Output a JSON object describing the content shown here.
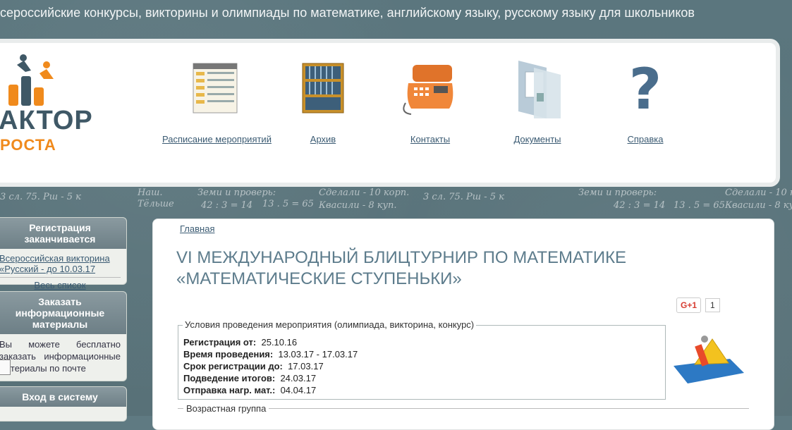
{
  "site_title": "Всероссийские конкурсы, викторины и олимпиады по математике, английскому языку, русскому языку для школьников",
  "logo": {
    "word1": "АКТОР",
    "word2": "РОСТА",
    "colors": {
      "primary": "#3f5866",
      "accent": "#f08a1c"
    }
  },
  "nav": [
    {
      "label": "Расписание мероприятий",
      "icon": "schedule-table-icon"
    },
    {
      "label": "Архив",
      "icon": "archive-shelf-icon"
    },
    {
      "label": "Контакты",
      "icon": "phone-icon"
    },
    {
      "label": "Документы",
      "icon": "documents-folder-icon"
    },
    {
      "label": "Справка",
      "icon": "help-question-icon"
    }
  ],
  "chalk_text": [
    "3 сл. 75. Рш - 5 к",
    "Наш.",
    "Тёльше",
    "Земи и проверь:",
    "42 : 3 = 14",
    "13 . 5 = 65",
    "Сделали - 10 корп.",
    "Квасили - 8 куп."
  ],
  "sidebar": {
    "registration": {
      "title": "Регистрация заканчивается",
      "item": "Всероссийская викторина «Русский - до 10.03.17",
      "all_link": "Весь список"
    },
    "materials": {
      "title": "Заказать информационные материалы",
      "text": "Вы можете бесплатно заказать информационные материалы по почте"
    },
    "login": {
      "title": "Вход в систему"
    }
  },
  "main": {
    "breadcrumb": "Главная",
    "title": "VI МЕЖДУНАРОДНЫЙ БЛИЦТУРНИР ПО МАТЕМАТИКЕ «МАТЕМАТИЧЕСКИЕ СТУПЕНЬКИ»",
    "gplus_label": "G+1",
    "gplus_count": "1",
    "conditions": {
      "legend": "Условия проведения мероприятия (олимпиада, викторина, конкурс)",
      "rows": [
        {
          "label": "Регистрация от:",
          "value": "25.10.16"
        },
        {
          "label": "Время проведения:",
          "value": "13.03.17 - 17.03.17"
        },
        {
          "label": "Срок регистрации до:",
          "value": "17.03.17"
        },
        {
          "label": "Подведение итогов:",
          "value": "24.03.17"
        },
        {
          "label": "Отправка нагр. мат.:",
          "value": "04.04.17"
        }
      ]
    },
    "age_group": "Возрастная группа"
  }
}
